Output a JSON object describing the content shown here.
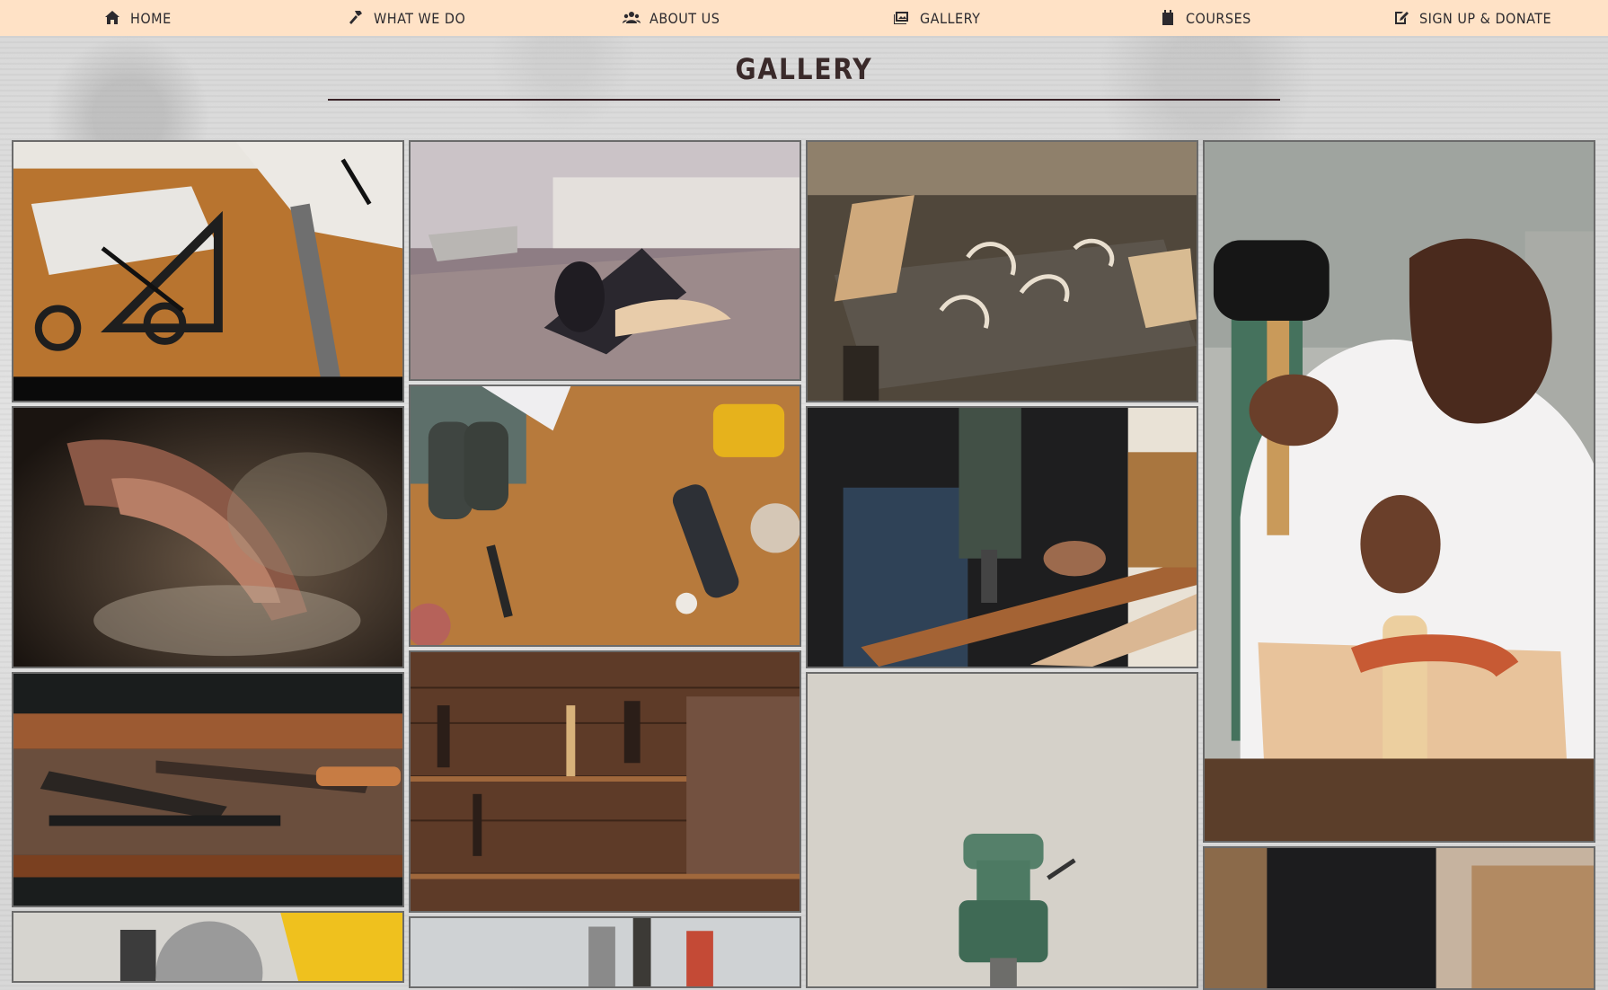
{
  "nav": {
    "items": [
      {
        "label": "HOME",
        "icon": "home-icon"
      },
      {
        "label": "WHAT WE DO",
        "icon": "hammer-icon"
      },
      {
        "label": "ABOUT US",
        "icon": "users-icon"
      },
      {
        "label": "GALLERY",
        "icon": "images-icon"
      },
      {
        "label": "COURSES",
        "icon": "calendar-icon"
      },
      {
        "label": "SIGN UP & DONATE",
        "icon": "signup-icon"
      }
    ]
  },
  "page": {
    "title": "GALLERY"
  },
  "gallery": {
    "images": [
      {
        "subject": "drafting tools on wooden table"
      },
      {
        "subject": "hand plane with wood shavings"
      },
      {
        "subject": "weathered workbench with shavings"
      },
      {
        "subject": "craftsman carving wood with mallet and chisel"
      },
      {
        "subject": "hands brushing sawdust"
      },
      {
        "subject": "power tools on wooden workbench"
      },
      {
        "subject": "drilling a wooden board"
      },
      {
        "subject": "hand tools on workbench"
      },
      {
        "subject": "woodworking shop wall with tools"
      },
      {
        "subject": "benchtop drill press"
      },
      {
        "subject": "yellow circular saw"
      },
      {
        "subject": "people at workshop fair"
      },
      {
        "subject": "person working in woodshop"
      }
    ]
  },
  "colors": {
    "nav_bg": "#ffe2c6",
    "text": "#2c2a2e",
    "title": "#3a2a2a",
    "rule": "#3a2328"
  }
}
